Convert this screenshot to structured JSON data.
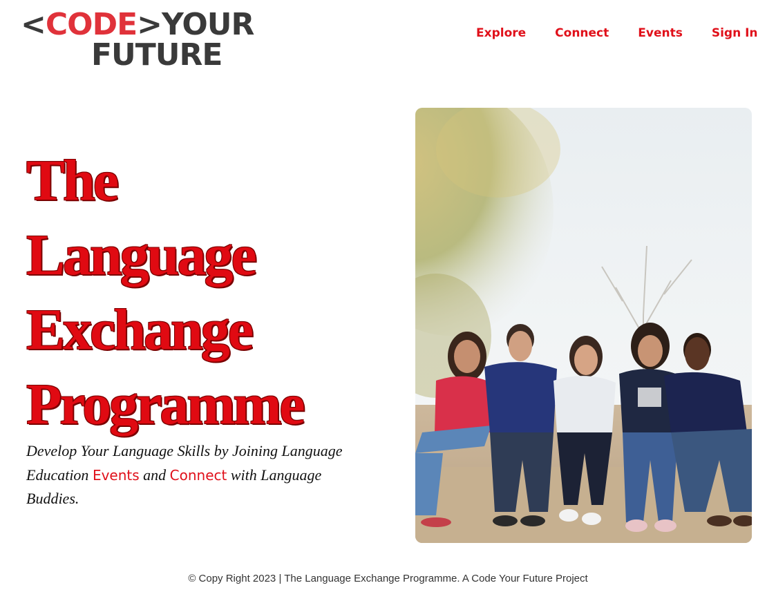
{
  "logo": {
    "open_bracket": "<",
    "code": "CODE",
    "close_bracket": ">",
    "your": "YOUR",
    "future": "FUTURE"
  },
  "nav": {
    "items": [
      {
        "label": "Explore"
      },
      {
        "label": "Connect"
      },
      {
        "label": "Events"
      },
      {
        "label": "Sign In"
      }
    ]
  },
  "hero": {
    "title_lines": [
      "The",
      "Language",
      "Exchange",
      "Programme"
    ],
    "subtitle_part1": "Develop Your Language Skills by Joining Language Education ",
    "subtitle_events_link": "Events",
    "subtitle_part2": " and ",
    "subtitle_connect_link": "Connect",
    "subtitle_part3": " with Language Buddies."
  },
  "colors": {
    "accent": "#e0101a",
    "logo_red": "#e0323a",
    "logo_dark": "#3a3a3a"
  },
  "footer": {
    "text": "© Copy Right 2023 | The Language Exchange Programme. A Code Your Future Project"
  }
}
